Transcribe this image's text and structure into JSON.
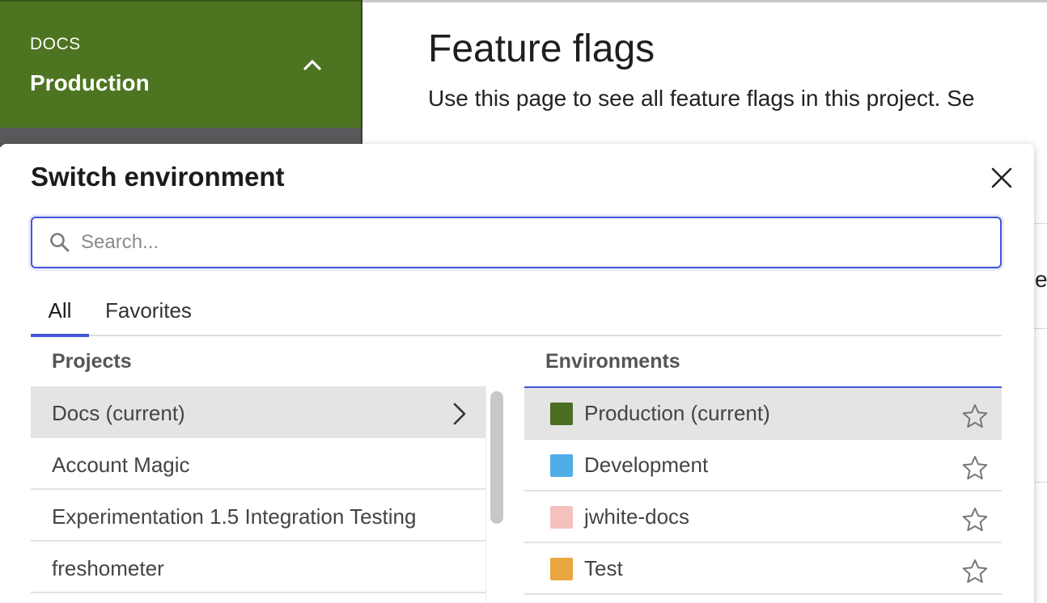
{
  "sidebar": {
    "project_name": "DOCS",
    "environment_name": "Production",
    "header_color": "#4d7420"
  },
  "page": {
    "title": "Feature flags",
    "subtitle": "Use this page to see all feature flags in this project. Se",
    "fragment": "er"
  },
  "modal": {
    "title": "Switch environment",
    "search_placeholder": "Search...",
    "tabs": [
      {
        "label": "All",
        "active": true
      },
      {
        "label": "Favorites",
        "active": false
      }
    ],
    "projects_heading": "Projects",
    "environments_heading": "Environments",
    "projects": [
      {
        "label": "Docs (current)",
        "selected": true
      },
      {
        "label": "Account Magic",
        "selected": false
      },
      {
        "label": "Experimentation 1.5 Integration Testing",
        "selected": false
      },
      {
        "label": "freshometer",
        "selected": false
      }
    ],
    "environments": [
      {
        "label": "Production (current)",
        "color": "#4a6d22",
        "selected": true
      },
      {
        "label": "Development",
        "color": "#4faee8",
        "selected": false
      },
      {
        "label": "jwhite-docs",
        "color": "#f4c1bd",
        "selected": false
      },
      {
        "label": "Test",
        "color": "#eaa640",
        "selected": false
      }
    ]
  },
  "colors": {
    "accent": "#4356d8"
  }
}
